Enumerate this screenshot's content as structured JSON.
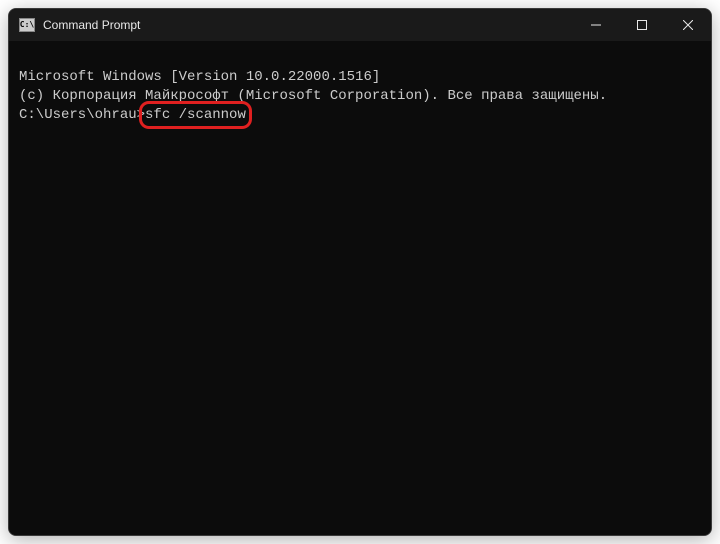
{
  "titlebar": {
    "title": "Command Prompt",
    "icon_label": "cmd-icon"
  },
  "terminal": {
    "line1": "Microsoft Windows [Version 10.0.22000.1516]",
    "line2": "(c) Корпорация Майкрософт (Microsoft Corporation). Все права защищены.",
    "blank": "",
    "prompt_path": "C:\\Users\\ohrau>",
    "command": "sfc /scannow"
  },
  "annotation": {
    "color": "#e02020"
  }
}
